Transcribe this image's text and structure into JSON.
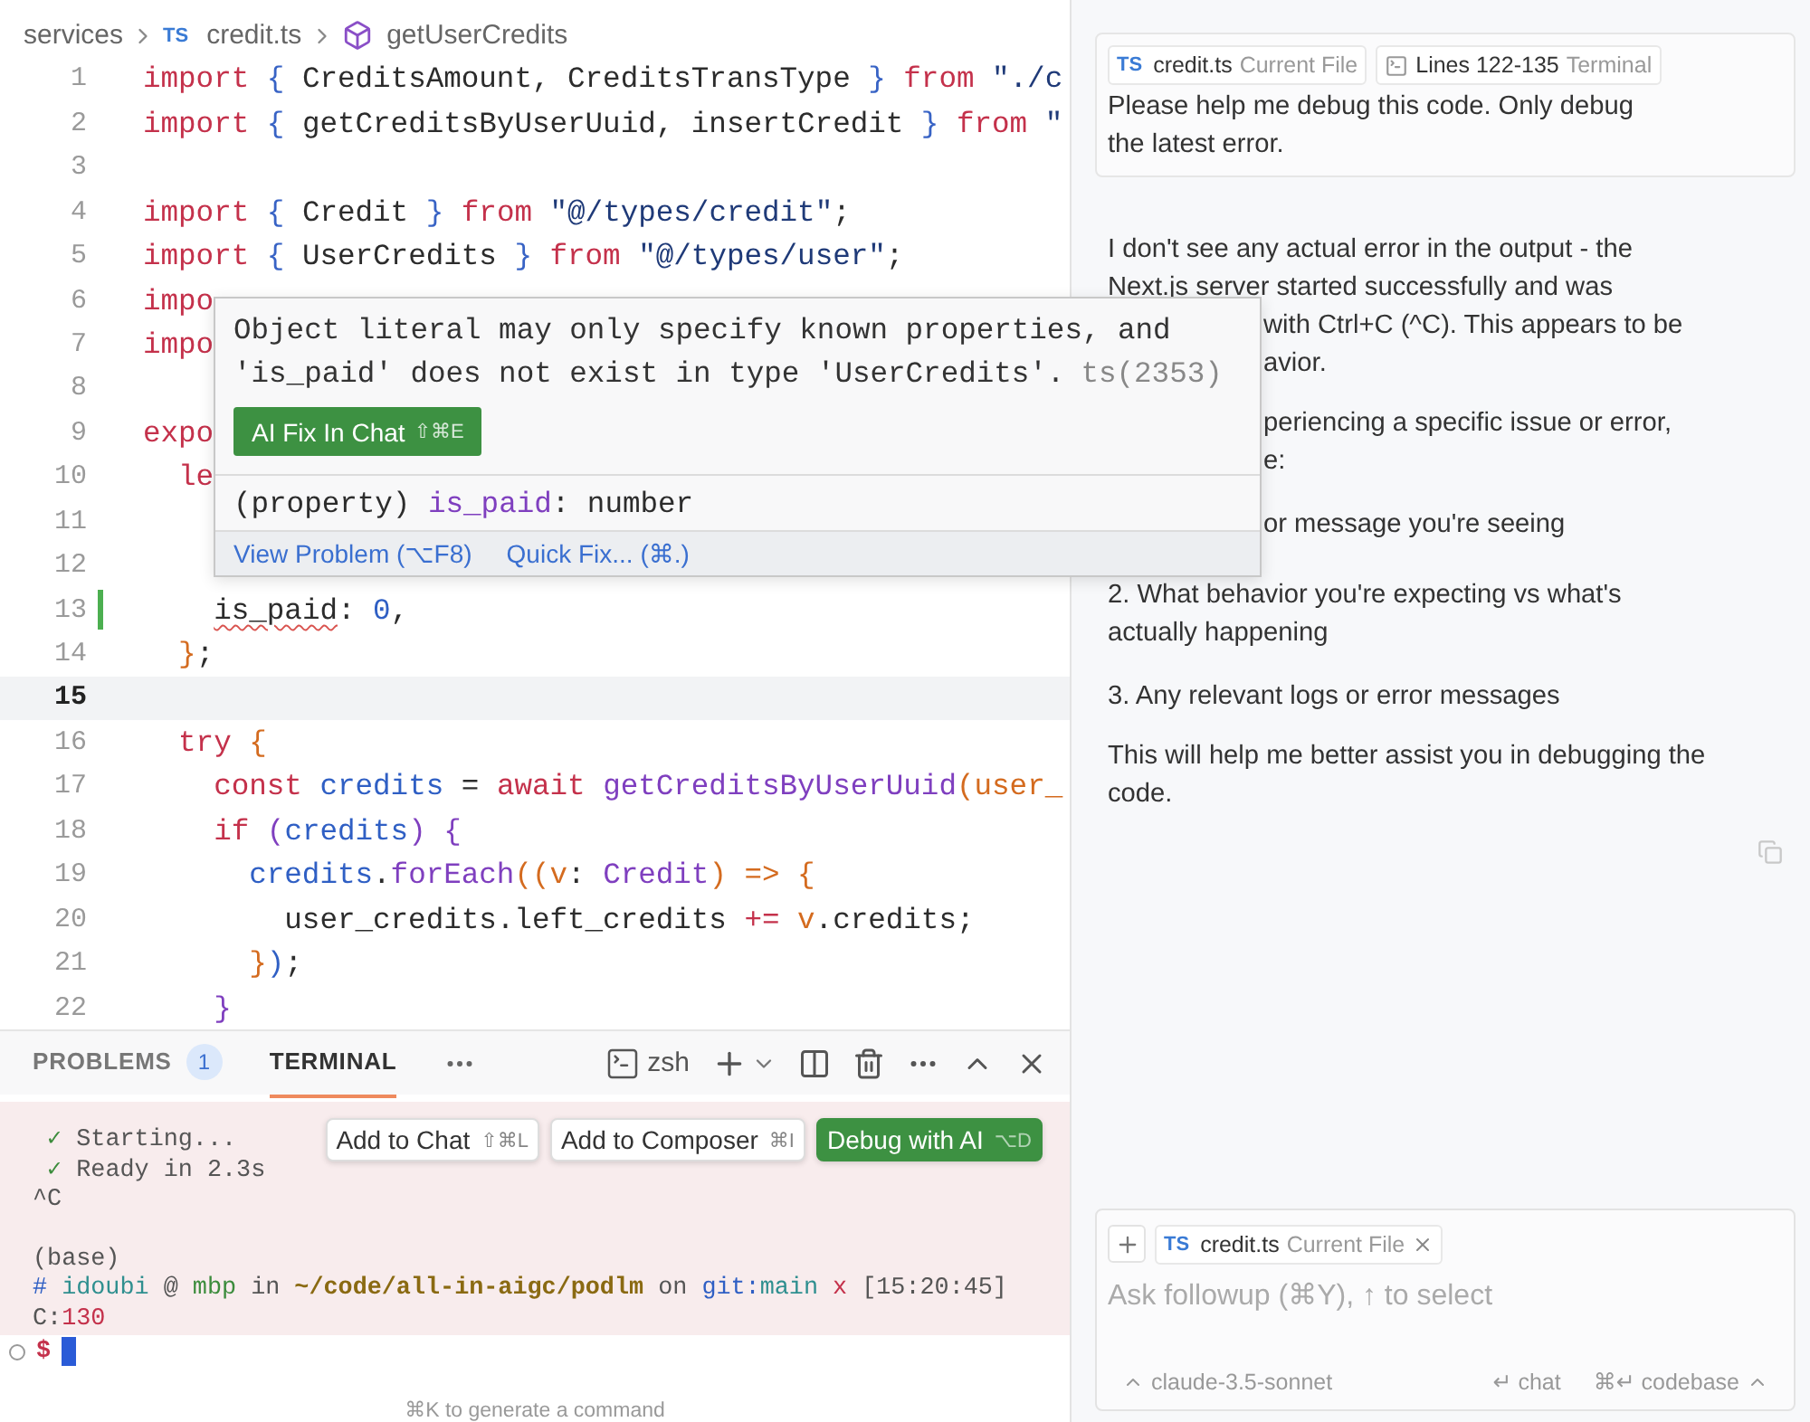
{
  "breadcrumb": [
    {
      "kind": "folder",
      "label": "services"
    },
    {
      "kind": "file",
      "badge": "TS",
      "label": "credit.ts"
    },
    {
      "kind": "symbol",
      "label": "getUserCredits"
    }
  ],
  "editor": {
    "lines": [
      {
        "number": "1",
        "current": false,
        "modified": false,
        "tokens": [
          {
            "text": "import ",
            "kind": "kw"
          },
          {
            "text": "{ ",
            "kind": "br"
          },
          {
            "text": "CreditsAmount, CreditsTransType ",
            "kind": "pl"
          },
          {
            "text": "} ",
            "kind": "br"
          },
          {
            "text": "from ",
            "kind": "kw"
          },
          {
            "text": "\"./c",
            "kind": "str"
          }
        ]
      },
      {
        "number": "2",
        "current": false,
        "modified": false,
        "tokens": [
          {
            "text": "import ",
            "kind": "kw"
          },
          {
            "text": "{ ",
            "kind": "br"
          },
          {
            "text": "getCreditsByUserUuid, insertCredit ",
            "kind": "pl"
          },
          {
            "text": "} ",
            "kind": "br"
          },
          {
            "text": "from ",
            "kind": "kw"
          },
          {
            "text": "\"",
            "kind": "str"
          }
        ]
      },
      {
        "number": "3",
        "current": false,
        "modified": false
      },
      {
        "number": "4",
        "current": false,
        "modified": false,
        "tokens": [
          {
            "text": "import ",
            "kind": "kw"
          },
          {
            "text": "{ ",
            "kind": "br"
          },
          {
            "text": "Credit ",
            "kind": "pl"
          },
          {
            "text": "} ",
            "kind": "br"
          },
          {
            "text": "from ",
            "kind": "kw"
          },
          {
            "text": "\"@/types/credit\"",
            "kind": "str"
          },
          {
            "text": ";",
            "kind": "pl"
          }
        ]
      },
      {
        "number": "5",
        "current": false,
        "modified": false,
        "tokens": [
          {
            "text": "import ",
            "kind": "kw"
          },
          {
            "text": "{ ",
            "kind": "br"
          },
          {
            "text": "UserCredits ",
            "kind": "pl"
          },
          {
            "text": "} ",
            "kind": "br"
          },
          {
            "text": "from ",
            "kind": "kw"
          },
          {
            "text": "\"@/types/user\"",
            "kind": "str"
          },
          {
            "text": ";",
            "kind": "pl"
          }
        ]
      },
      {
        "number": "6",
        "current": false,
        "modified": false,
        "tokens": [
          {
            "text": "impo",
            "kind": "kw"
          }
        ]
      },
      {
        "number": "7",
        "current": false,
        "modified": false,
        "tokens": [
          {
            "text": "impo",
            "kind": "kw"
          }
        ]
      },
      {
        "number": "8",
        "current": false,
        "modified": false
      },
      {
        "number": "9",
        "current": false,
        "modified": false,
        "tokens": [
          {
            "text": "expo",
            "kind": "kw"
          }
        ]
      },
      {
        "number": "10",
        "current": false,
        "modified": false,
        "tokens": [
          {
            "text": "  le",
            "kind": "kw"
          }
        ]
      },
      {
        "number": "11",
        "current": false,
        "modified": false
      },
      {
        "number": "12",
        "current": false,
        "modified": false
      },
      {
        "number": "13",
        "current": false,
        "modified": true,
        "tokens": [
          {
            "text": "    is_paid",
            "kind": "err"
          },
          {
            "text": ": ",
            "kind": "pl"
          },
          {
            "text": "0",
            "kind": "num"
          },
          {
            "text": ",",
            "kind": "pl"
          }
        ]
      },
      {
        "number": "14",
        "current": false,
        "modified": false,
        "tokens": [
          {
            "text": "  }",
            "kind": "or"
          },
          {
            "text": ";",
            "kind": "pl"
          }
        ]
      },
      {
        "number": "15",
        "current": true,
        "modified": false
      },
      {
        "number": "16",
        "current": false,
        "modified": false,
        "tokens": [
          {
            "text": "  try ",
            "kind": "kw"
          },
          {
            "text": "{",
            "kind": "or"
          }
        ]
      },
      {
        "number": "17",
        "current": false,
        "modified": false,
        "tokens": [
          {
            "text": "    const ",
            "kind": "kw"
          },
          {
            "text": "credits ",
            "kind": "var"
          },
          {
            "text": "= ",
            "kind": "pl"
          },
          {
            "text": "await ",
            "kind": "kw"
          },
          {
            "text": "getCreditsByUserUuid",
            "kind": "fn"
          },
          {
            "text": "(user_",
            "kind": "or"
          }
        ]
      },
      {
        "number": "18",
        "current": false,
        "modified": false,
        "tokens": [
          {
            "text": "    if ",
            "kind": "kw"
          },
          {
            "text": "(",
            "kind": "fn"
          },
          {
            "text": "credits",
            "kind": "var"
          },
          {
            "text": ") {",
            "kind": "fn"
          }
        ]
      },
      {
        "number": "19",
        "current": false,
        "modified": false,
        "tokens": [
          {
            "text": "      credits",
            "kind": "var"
          },
          {
            "text": ".",
            "kind": "pl"
          },
          {
            "text": "forEach",
            "kind": "fn"
          },
          {
            "text": "((v",
            "kind": "or"
          },
          {
            "text": ": ",
            "kind": "pl"
          },
          {
            "text": "Credit",
            "kind": "fn"
          },
          {
            "text": ") => {",
            "kind": "or"
          }
        ]
      },
      {
        "number": "20",
        "current": false,
        "modified": false,
        "tokens": [
          {
            "text": "        user_credits.left_credits ",
            "kind": "pl"
          },
          {
            "text": "+= ",
            "kind": "kw"
          },
          {
            "text": "v",
            "kind": "or"
          },
          {
            "text": ".credits;",
            "kind": "pl"
          }
        ]
      },
      {
        "number": "21",
        "current": false,
        "modified": false,
        "tokens": [
          {
            "text": "      }",
            "kind": "or"
          },
          {
            "text": ")",
            "kind": "var"
          },
          {
            "text": ";",
            "kind": "pl"
          }
        ]
      },
      {
        "number": "22",
        "current": false,
        "modified": false,
        "tokens": [
          {
            "text": "    }",
            "kind": "fn"
          }
        ]
      }
    ]
  },
  "hover": {
    "message_lines": [
      "Object literal may only specify known properties, and",
      "'is_paid' does not exist in type 'UserCredits'."
    ],
    "code": "ts(2353)",
    "fix_button": {
      "label": "AI Fix In Chat",
      "shortcut": "⇧⌘E"
    },
    "signature": [
      {
        "text": "(property) ",
        "kind": "pl"
      },
      {
        "text": "is_paid",
        "kind": "fn"
      },
      {
        "text": ": number",
        "kind": "pl"
      }
    ],
    "links": [
      "View Problem (⌥F8)",
      "Quick Fix... (⌘.)"
    ]
  },
  "panel": {
    "tabs": [
      {
        "label": "PROBLEMS",
        "count": "1",
        "selected": false
      },
      {
        "label": "TERMINAL",
        "selected": true
      }
    ],
    "shell": "zsh"
  },
  "terminal": {
    "blocks": [
      [
        {
          "tokens": [
            {
              "text": " ✓ ",
              "kind": "ok"
            },
            {
              "text": "Starting...",
              "kind": "pl"
            }
          ]
        },
        {
          "tokens": [
            {
              "text": " ✓ ",
              "kind": "ok"
            },
            {
              "text": "Ready in 2.3s",
              "kind": "pl"
            }
          ]
        },
        {
          "tokens": [
            {
              "text": "^C",
              "kind": "pl"
            }
          ]
        }
      ],
      [
        {
          "tokens": [
            {
              "text": "(base)",
              "kind": "pl"
            }
          ]
        },
        {
          "tokens": [
            {
              "text": "# ",
              "kind": "hash"
            },
            {
              "text": "idoubi ",
              "kind": "user"
            },
            {
              "text": "@ ",
              "kind": "pl"
            },
            {
              "text": "mbp ",
              "kind": "host"
            },
            {
              "text": "in ",
              "kind": "pl"
            },
            {
              "text": "~/code/all-in-aigc/podlm ",
              "kind": "path"
            },
            {
              "text": "on ",
              "kind": "pl"
            },
            {
              "text": "git:",
              "kind": "hash"
            },
            {
              "text": "main ",
              "kind": "user"
            },
            {
              "text": "x ",
              "kind": "x"
            },
            {
              "text": "[15:20:45]",
              "kind": "pl"
            }
          ]
        },
        {
          "tokens": [
            {
              "text": "C:",
              "kind": "pl"
            },
            {
              "text": "130",
              "kind": "x"
            }
          ]
        }
      ]
    ],
    "actions": [
      {
        "label": "Add to Chat",
        "shortcut": "⇧⌘L",
        "kind": "plain"
      },
      {
        "label": "Add to Composer",
        "shortcut": "⌘I",
        "kind": "plain"
      },
      {
        "label": "Debug with AI",
        "shortcut": "⌥D",
        "kind": "primary"
      }
    ],
    "prompt": "$",
    "hint": "⌘K to generate a command"
  },
  "chat": {
    "user_message": {
      "context": [
        {
          "kind": "file",
          "badge": "TS",
          "name": "credit.ts",
          "hint": "Current File"
        },
        {
          "kind": "terminal",
          "name": "Lines 122-135",
          "hint": "Terminal"
        }
      ],
      "text": "Please help me debug this code. Only debug the latest error."
    },
    "response": [
      [
        {
          "text": "I don't see any actual error in the output - the"
        },
        {
          "text": "Next.js server started successfully and was"
        },
        {
          "text": "with Ctrl+C (^C). This appears to be",
          "covered": true
        },
        {
          "text": "avior.",
          "covered": true
        }
      ],
      [
        {
          "text": "periencing a specific issue or error,",
          "covered": true
        },
        {
          "text": "e:",
          "covered": true
        }
      ],
      [
        {
          "text": "or message you're seeing",
          "covered": true
        }
      ],
      [
        {
          "text": "2. What behavior you're expecting vs what's"
        },
        {
          "text": "actually happening"
        }
      ],
      [
        {
          "text": "3. Any relevant logs or error messages"
        }
      ],
      [
        {
          "text": "This will help me better assist you in debugging the"
        },
        {
          "text": "code."
        }
      ]
    ],
    "input": {
      "context": [
        {
          "kind": "file",
          "badge": "TS",
          "name": "credit.ts",
          "hint": "Current File"
        }
      ],
      "placeholder": "Ask followup (⌘Y), ↑ to select",
      "model": "claude-3.5-sonnet",
      "shortcuts": [
        "↵ chat",
        "⌘↵ codebase"
      ]
    }
  }
}
